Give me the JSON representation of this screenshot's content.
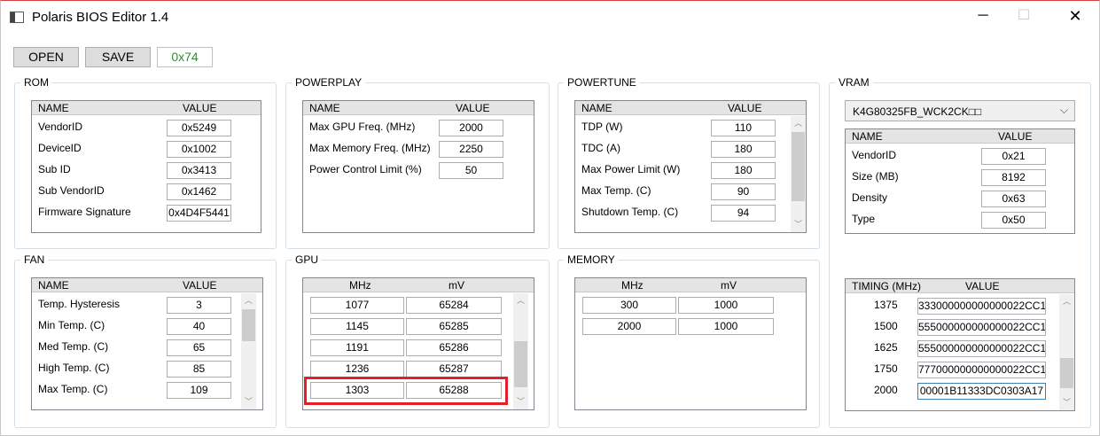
{
  "window": {
    "title": "Polaris BIOS Editor 1.4",
    "minimize": "─",
    "maximize": "☐",
    "close": "✕"
  },
  "toolbar": {
    "open_label": "OPEN",
    "save_label": "SAVE",
    "hex_value": "0x74",
    "hex_color": "#2e8b2e"
  },
  "rom": {
    "label": "ROM",
    "col_name": "NAME",
    "col_value": "VALUE",
    "rows": [
      {
        "name": "VendorID",
        "value": "0x5249"
      },
      {
        "name": "DeviceID",
        "value": "0x1002"
      },
      {
        "name": "Sub ID",
        "value": "0x3413"
      },
      {
        "name": "Sub VendorID",
        "value": "0x1462"
      },
      {
        "name": "Firmware Signature",
        "value": "0x4D4F5441"
      }
    ]
  },
  "powerplay": {
    "label": "POWERPLAY",
    "col_name": "NAME",
    "col_value": "VALUE",
    "rows": [
      {
        "name": "Max GPU Freq. (MHz)",
        "value": "2000"
      },
      {
        "name": "Max Memory Freq. (MHz)",
        "value": "2250"
      },
      {
        "name": "Power Control Limit (%)",
        "value": "50"
      }
    ]
  },
  "powertune": {
    "label": "POWERTUNE",
    "col_name": "NAME",
    "col_value": "VALUE",
    "rows": [
      {
        "name": "TDP (W)",
        "value": "110"
      },
      {
        "name": "TDC (A)",
        "value": "180"
      },
      {
        "name": "Max Power Limit (W)",
        "value": "180"
      },
      {
        "name": "Max Temp. (C)",
        "value": "90"
      },
      {
        "name": "Shutdown Temp. (C)",
        "value": "94"
      }
    ]
  },
  "vram": {
    "label": "VRAM",
    "selected": "K4G80325FB_WCK2CK□□",
    "col_name": "NAME",
    "col_value": "VALUE",
    "rows": [
      {
        "name": "VendorID",
        "value": "0x21"
      },
      {
        "name": "Size (MB)",
        "value": "8192"
      },
      {
        "name": "Density",
        "value": "0x63"
      },
      {
        "name": "Type",
        "value": "0x50"
      }
    ],
    "timing_col_name": "TIMING (MHz)",
    "timing_col_value": "VALUE",
    "timings": [
      {
        "mhz": "1375",
        "value": "333000000000000022CC1"
      },
      {
        "mhz": "1500",
        "value": "555000000000000022CC1"
      },
      {
        "mhz": "1625",
        "value": "555000000000000022CC1"
      },
      {
        "mhz": "1750",
        "value": "777000000000000022CC1"
      },
      {
        "mhz": "2000",
        "value": "00001B11333DC0303A17"
      }
    ]
  },
  "fan": {
    "label": "FAN",
    "col_name": "NAME",
    "col_value": "VALUE",
    "rows": [
      {
        "name": "Temp. Hysteresis",
        "value": "3"
      },
      {
        "name": "Min Temp. (C)",
        "value": "40"
      },
      {
        "name": "Med Temp. (C)",
        "value": "65"
      },
      {
        "name": "High Temp. (C)",
        "value": "85"
      },
      {
        "name": "Max Temp. (C)",
        "value": "109"
      }
    ]
  },
  "gpu": {
    "label": "GPU",
    "col_mhz": "MHz",
    "col_mv": "mV",
    "rows": [
      {
        "mhz": "1077",
        "mv": "65284"
      },
      {
        "mhz": "1145",
        "mv": "65285"
      },
      {
        "mhz": "1191",
        "mv": "65286"
      },
      {
        "mhz": "1236",
        "mv": "65287"
      },
      {
        "mhz": "1303",
        "mv": "65288"
      }
    ],
    "highlight_color": "#e0202a"
  },
  "memory": {
    "label": "MEMORY",
    "col_mhz": "MHz",
    "col_mv": "mV",
    "rows": [
      {
        "mhz": "300",
        "mv": "1000"
      },
      {
        "mhz": "2000",
        "mv": "1000"
      }
    ]
  },
  "icons": {
    "scroll_up": "︿",
    "scroll_down": "﹀",
    "dropdown": "⌵"
  }
}
